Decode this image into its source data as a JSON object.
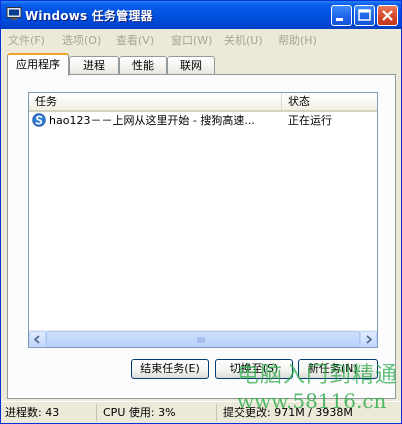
{
  "window": {
    "title": "Windows 任务管理器",
    "icon": "monitor-icon",
    "controls": {
      "minimize": "minimize-icon",
      "maximize": "maximize-icon",
      "close": "close-icon"
    }
  },
  "menu": [
    "文件(F)",
    "选项(O)",
    "查看(V)",
    "窗口(W)",
    "关机(U)",
    "帮助(H)"
  ],
  "tabs": [
    "应用程序",
    "进程",
    "性能",
    "联网"
  ],
  "active_tab": "应用程序",
  "list": {
    "columns": {
      "task": "任务",
      "status": "状态"
    },
    "rows": [
      {
        "name": "hao123－－上网从这里开始 - 搜狗高速...",
        "status": "正在运行",
        "icon": "sogou-browser-icon"
      }
    ]
  },
  "buttons": {
    "end_task": "结束任务(E)",
    "switch_to": "切换至(S)",
    "new_task": "新任务(N)..."
  },
  "statusbar": {
    "processes": "进程数: 43",
    "cpu": "CPU 使用: 3%",
    "commit": "提交更改: 971M / 3938M"
  },
  "watermark": {
    "text": "电脑入门到精通",
    "url": "www.58116.cn"
  },
  "colors": {
    "titlebar": "#0052e0",
    "window_bg": "#ece9d8",
    "tab_accent": "#f0a22a",
    "close": "#d4452a",
    "watermark": "#28aa46"
  }
}
